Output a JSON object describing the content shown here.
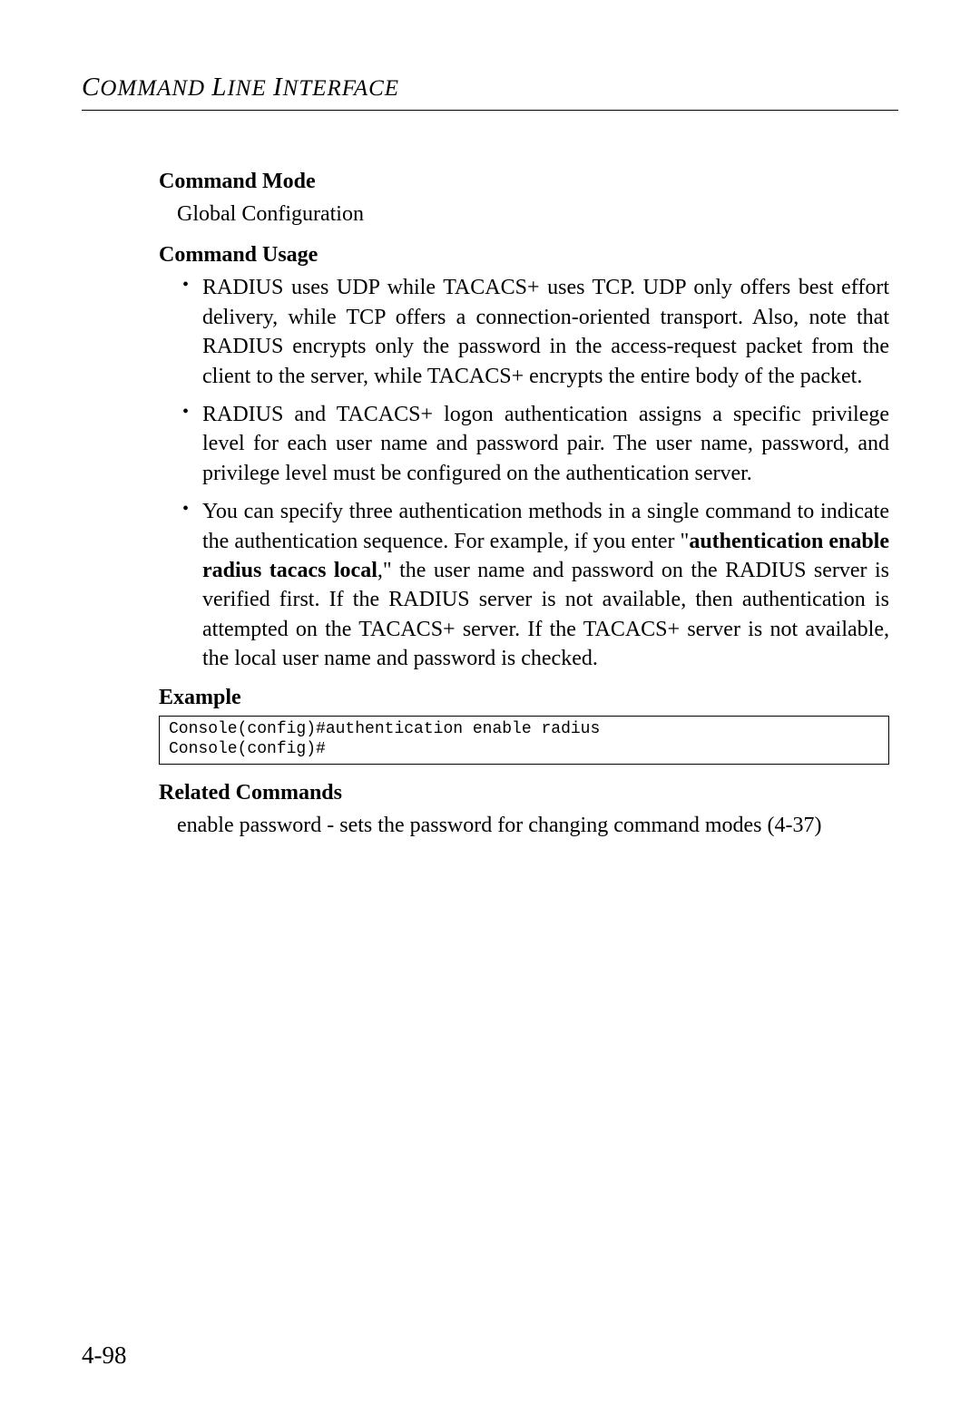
{
  "header": {
    "word1_cap": "C",
    "word1_rest": "OMMAND",
    "word2_cap": "L",
    "word2_rest": "INE",
    "word3_cap": "I",
    "word3_rest": "NTERFACE"
  },
  "sections": {
    "command_mode": {
      "heading": "Command Mode",
      "body": "Global Configuration"
    },
    "command_usage": {
      "heading": "Command Usage",
      "bullets": {
        "b1": "RADIUS uses UDP while TACACS+ uses TCP. UDP only offers best effort delivery, while TCP offers a connection-oriented transport. Also, note that RADIUS encrypts only the password in the access-request packet from the client to the server, while TACACS+ encrypts the entire body of the packet.",
        "b2": "RADIUS and TACACS+ logon authentication assigns a specific privilege level for each user name and password pair. The user name, password, and privilege level must be configured on the authentication server.",
        "b3_pre": "You can specify three authentication methods in a single command to indicate the authentication sequence. For example, if you enter \"",
        "b3_bold": "authentication enable radius tacacs local",
        "b3_post": ",\" the user name and password on the RADIUS server is verified first. If the RADIUS server is not available, then authentication is attempted on the TACACS+ server. If the TACACS+ server is not available, the local user name and password is checked."
      }
    },
    "example": {
      "heading": "Example",
      "code": "Console(config)#authentication enable radius\nConsole(config)#"
    },
    "related": {
      "heading": "Related Commands",
      "body": "enable password -  sets the password for changing command modes (4-37)"
    }
  },
  "page_number": "4-98"
}
